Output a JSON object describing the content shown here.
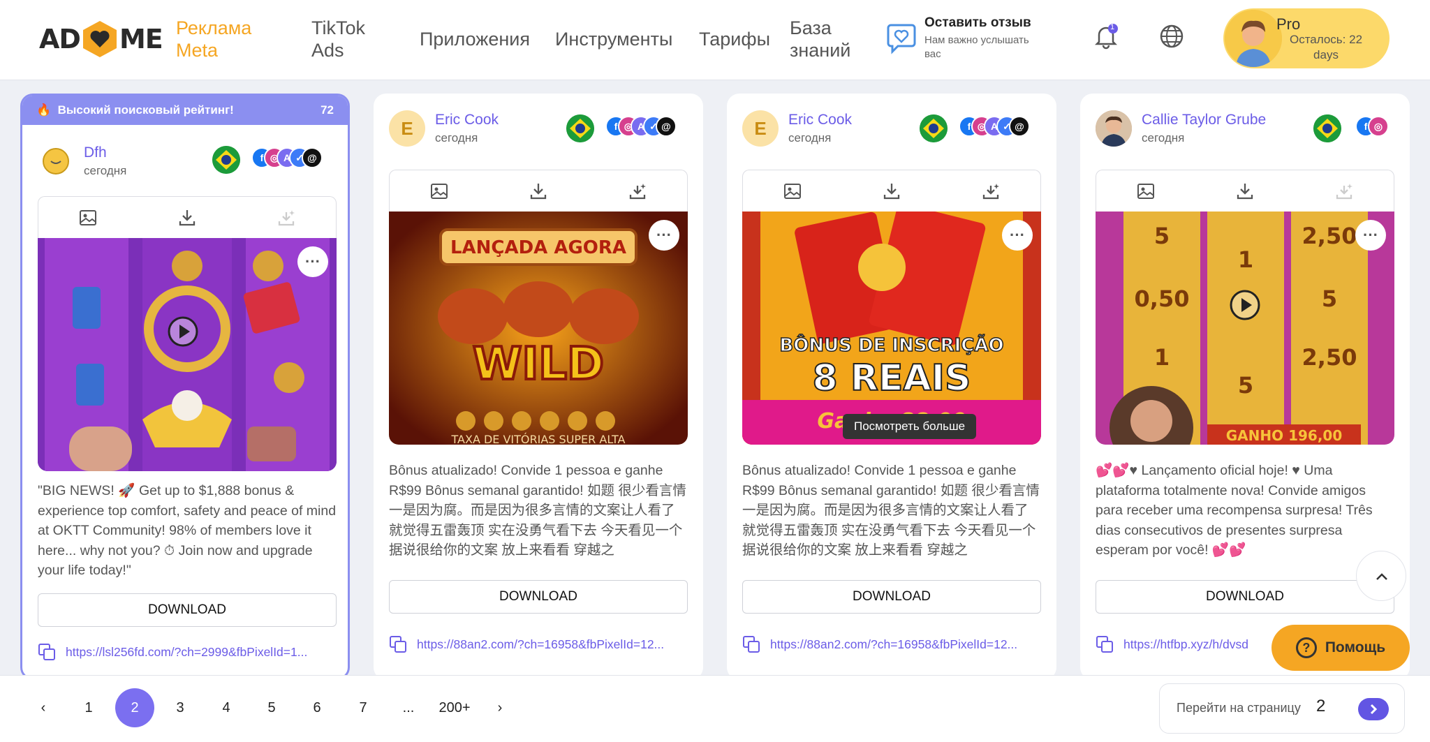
{
  "header": {
    "logo_left": "AD",
    "logo_right": "ME",
    "nav": [
      {
        "label": "Реклама Meta",
        "active": true
      },
      {
        "label": "TikTok Ads"
      },
      {
        "label": "Приложения"
      },
      {
        "label": "Инструменты"
      },
      {
        "label": "Тарифы"
      },
      {
        "label": "База знаний"
      }
    ],
    "feedback_title": "Оставить отзыв",
    "feedback_sub": "Нам важно услышать вас",
    "notifications_count": "1",
    "plan": "Pro",
    "plan_days": "Осталось: 22 days"
  },
  "cards": [
    {
      "highlight": "Высокий поисковый рейтинг!",
      "highlight_score": "72",
      "author": "Dfh",
      "date": "сегодня",
      "text": "\"BIG NEWS! 🚀 Get up to $1,888 bonus & experience top comfort, safety and peace of mind at OKTT Community! 98% of members love it here... why not you? ⏱ Join now and upgrade your life today!\"",
      "download": "DOWNLOAD",
      "link": "https://lsl256fd.com/?ch=2999&fbPixelId=1..."
    },
    {
      "avatar_letter": "E",
      "author": "Eric Cook",
      "date": "сегодня",
      "media_title": "LANÇADA AGORA",
      "media_main": "WILD",
      "media_footer": "TAXA DE VITÓRIAS SUPER ALTA",
      "text": "Bônus atualizado! Convide 1 pessoa e ganhe R$99 Bônus semanal garantido! 如题 很少看言情 一是因为腐。而是因为很多言情的文案让人看了就觉得五雷轰顶 实在没勇气看下去 今天看见一个据说很给你的文案 放上来看看 穿越之",
      "download": "DOWNLOAD",
      "link": "https://88an2.com/?ch=16958&fbPixelId=12..."
    },
    {
      "avatar_letter": "E",
      "author": "Eric Cook",
      "date": "сегодня",
      "media_line1": "BÔNUS DE INSCRIÇÃO",
      "media_line2": "8 REAIS",
      "media_footer": "Ganhe 88,00",
      "text": "Bônus atualizado! Convide 1 pessoa e ganhe R$99 Bônus semanal garantido! 如题 很少看言情 一是因为腐。而是因为很多言情的文案让人看了就觉得五雷轰顶 实在没勇气看下去 今天看见一个据说很给你的文案 放上来看看 穿越之",
      "download": "DOWNLOAD",
      "link": "https://88an2.com/?ch=16958&fbPixelId=12..."
    },
    {
      "author": "Callie Taylor Grube",
      "date": "сегодня",
      "media_values": [
        "5",
        "2,50",
        "1",
        "0,50",
        "5",
        "1",
        "2,50",
        "5"
      ],
      "media_footer": "GANHO 196,00",
      "text": "💕💕♥ Lançamento oficial hoje! ♥ Uma plataforma totalmente nova! Convide amigos para receber uma recompensa surpresa! Três dias consecutivos de presentes surpresa esperam por você! 💕💕",
      "download": "DOWNLOAD",
      "link": "https://htfbp.xyz/h/dvsd"
    }
  ],
  "tooltip": "Посмотреть больше",
  "pagination": {
    "pages": [
      "1",
      "2",
      "3",
      "4",
      "5",
      "6",
      "7",
      "...",
      "200+"
    ],
    "current": "2",
    "prev": "‹",
    "next": "›",
    "jump_label": "Перейти на страницу",
    "jump_value": "2"
  },
  "help_label": "Помощь",
  "colors": {
    "accent": "#f5a623",
    "primary": "#6b5ce7",
    "highlight": "#8b8ff0"
  },
  "icons": [
    "bell-icon",
    "globe-icon",
    "feedback-heart-icon",
    "image-icon",
    "download-icon",
    "magic-icon",
    "copy-icon",
    "play-icon",
    "chevron-up-icon",
    "help-icon"
  ]
}
